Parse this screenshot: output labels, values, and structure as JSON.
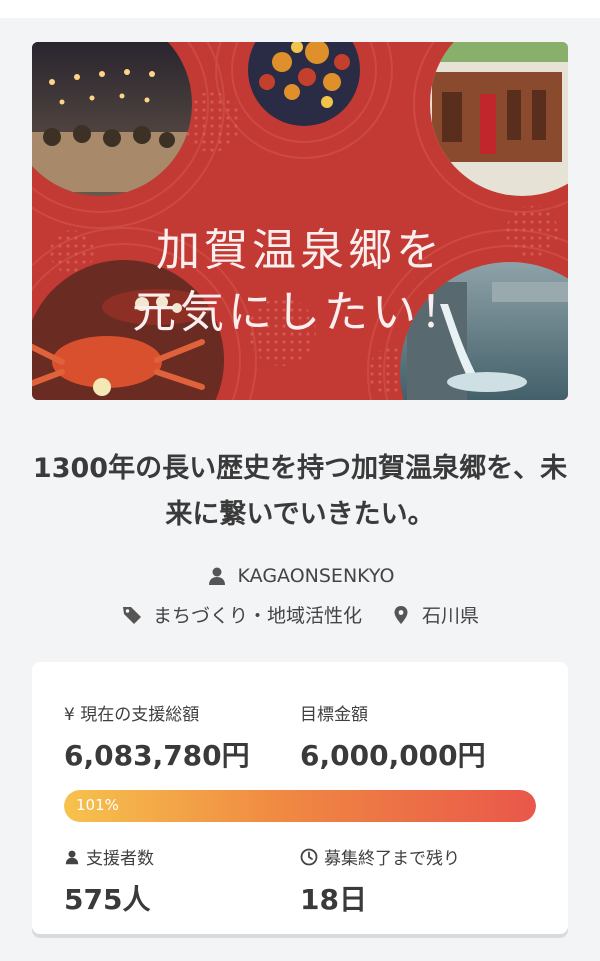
{
  "colors": {
    "hero_red": "#c23a33",
    "progress_start": "#f6c24d",
    "progress_end": "#e9574a",
    "text": "#3a3a3a"
  },
  "hero": {
    "title_line1": "加賀温泉郷を",
    "title_line2": "元気にしたい！",
    "photos": [
      "summer-festival-street-photo",
      "autumn-maple-leaves-photo",
      "traditional-townhouse-photo",
      "crab-dish-photo",
      "hot-spring-water-photo"
    ]
  },
  "project": {
    "title": "1300年の長い歴史を持つ加賀温泉郷を、未来に繋いでいきたい。",
    "owner": "KAGAONSENKYO",
    "category": "まちづくり・地域活性化",
    "location": "石川県",
    "icons": {
      "owner": "user-icon",
      "category": "tag-icon",
      "location": "map-pin-icon"
    }
  },
  "stats": {
    "raised_label": "¥ 現在の支援総額",
    "raised_value": "6,083,780円",
    "goal_label": "目標金額",
    "goal_value": "6,000,000円",
    "progress_percent": 101,
    "progress_label": "101%",
    "supporters_label": "支援者数",
    "supporters_value": "575人",
    "remaining_label": "募集終了まで残り",
    "remaining_value": "18日",
    "icons": {
      "supporters": "user-icon",
      "remaining": "clock-icon"
    }
  }
}
